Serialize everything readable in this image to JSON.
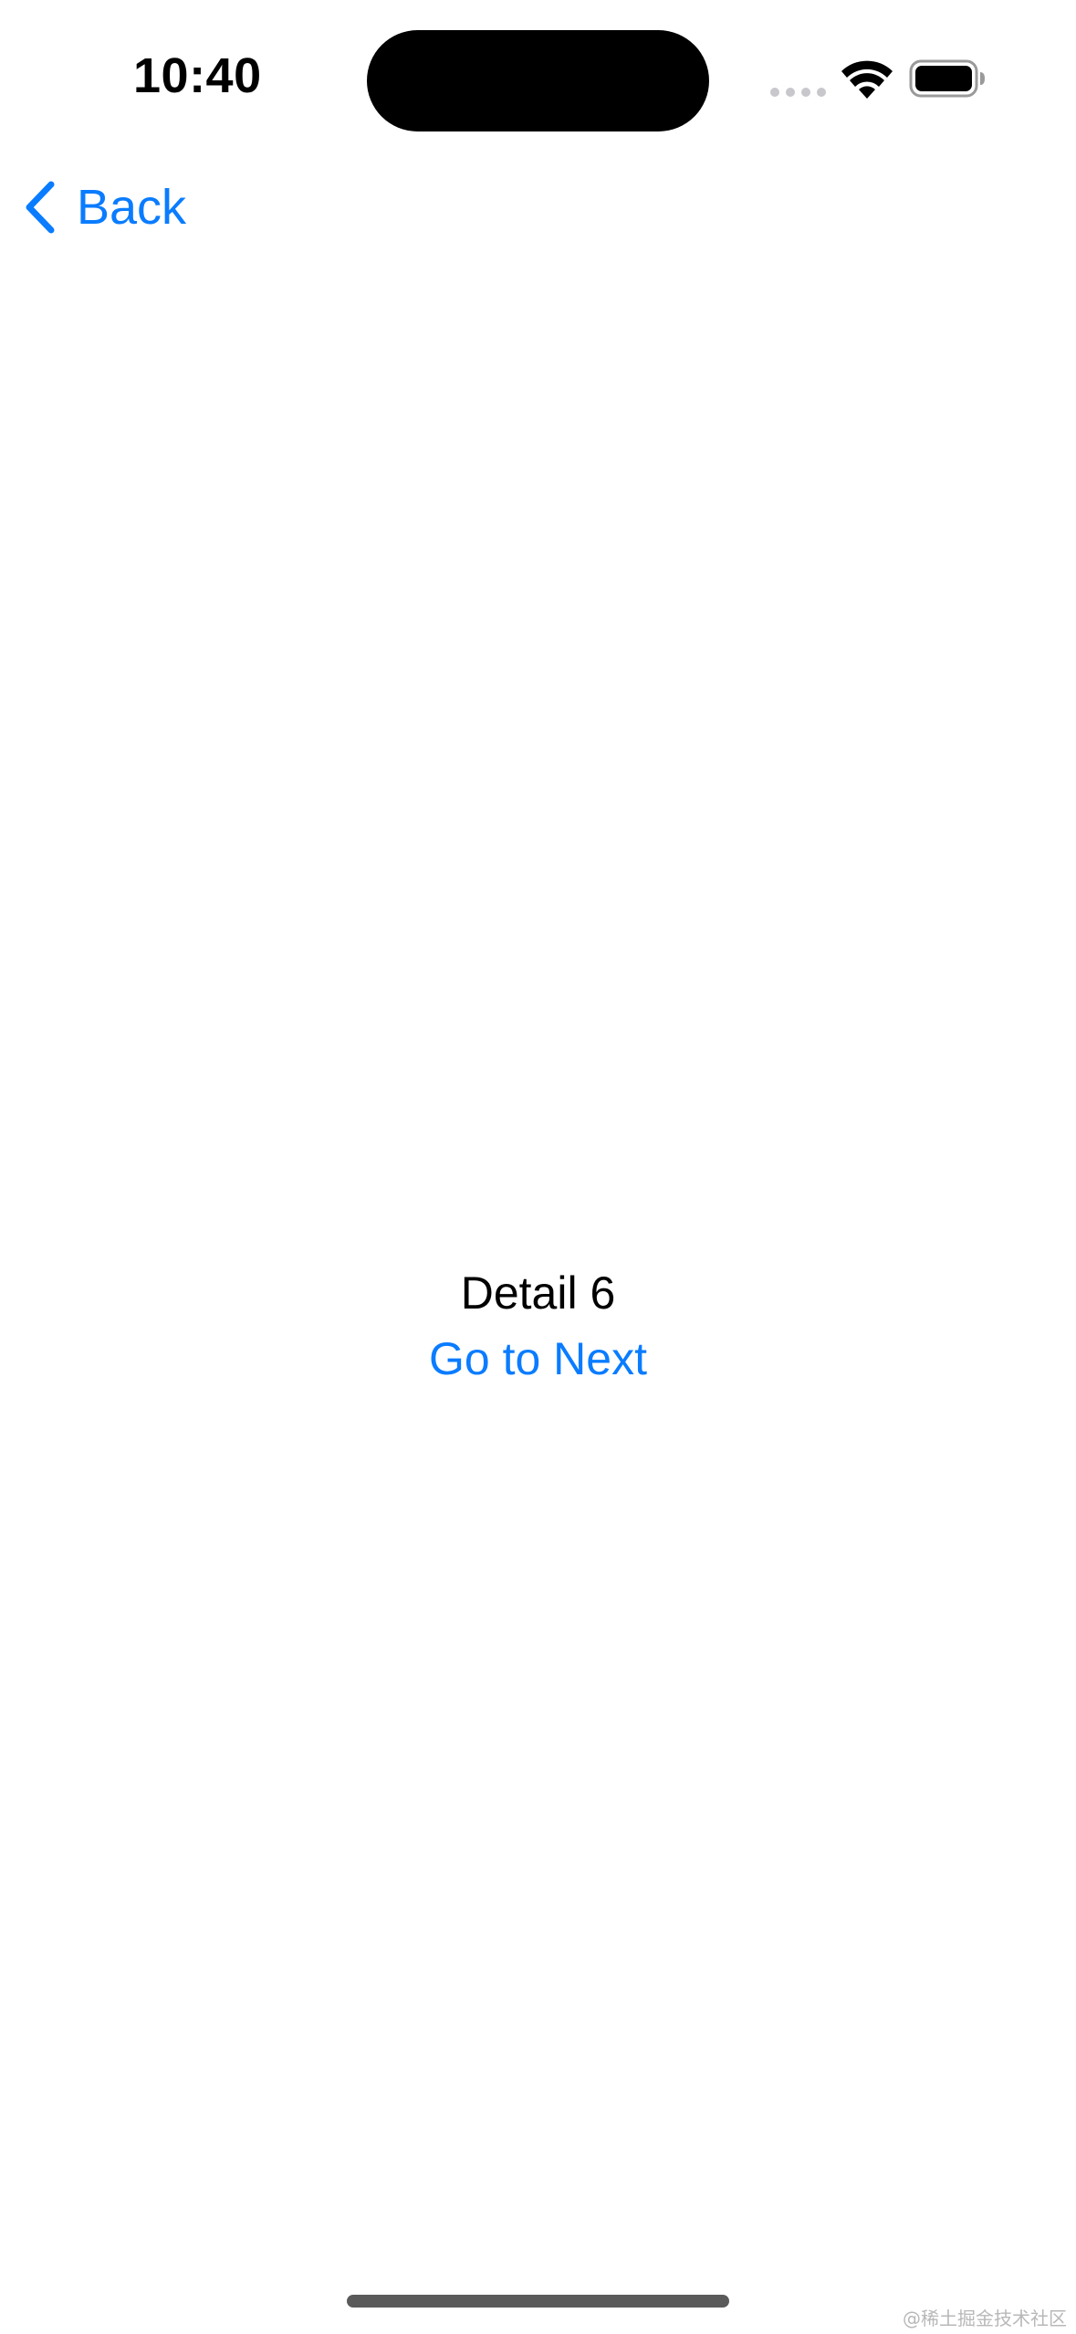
{
  "status_bar": {
    "time": "10:40",
    "icons": [
      "cellular-signal-icon",
      "wifi-icon",
      "battery-icon"
    ]
  },
  "nav": {
    "back_label": "Back",
    "back_icon": "chevron-left-icon"
  },
  "content": {
    "title": "Detail 6",
    "link_label": "Go to Next"
  },
  "watermark": "@稀土掘金技术社区",
  "colors": {
    "accent": "#0a7cff",
    "text": "#000000",
    "background": "#ffffff"
  }
}
